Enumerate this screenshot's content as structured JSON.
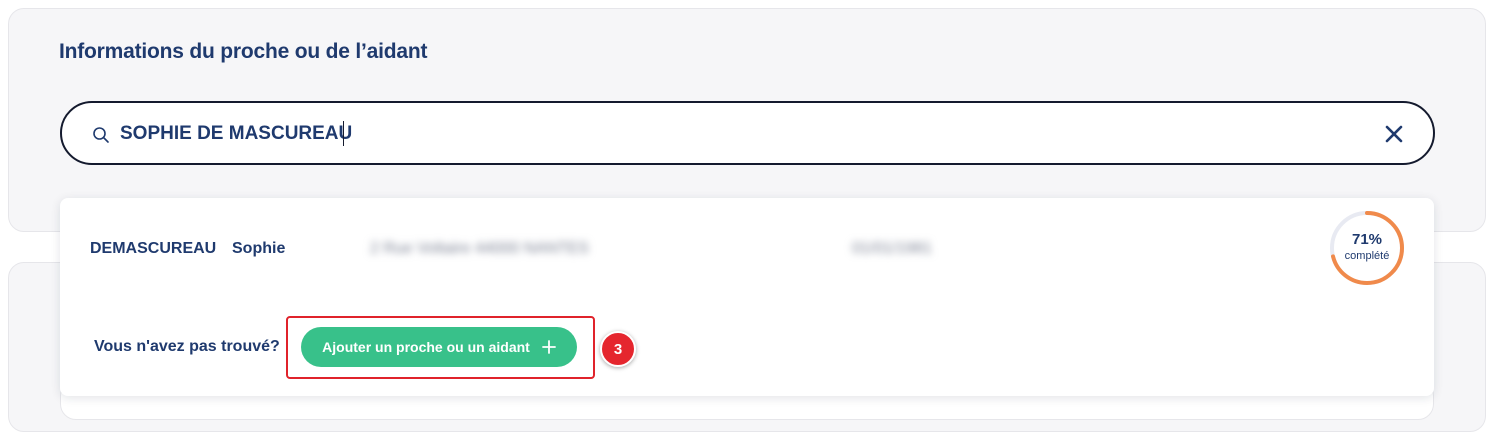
{
  "section": {
    "title": "Informations du proche ou de l’aidant"
  },
  "search": {
    "value": "SOPHIE DE MASCUREAU",
    "icon": "search-icon",
    "clear_icon": "close-icon"
  },
  "results": [
    {
      "last_name": "DEMASCUREAU",
      "first_name": "Sophie",
      "address": "2 Rue Voltaire 44000 NANTES",
      "birth_date": "01/01/1981",
      "completion": {
        "percent": 71,
        "label": "71%",
        "caption": "complété",
        "color": "#f08a4b",
        "track_color": "#e8eaf2"
      }
    }
  ],
  "not_found": {
    "question": "Vous n'avez pas trouvé?",
    "add_button_label": "Ajouter un proche ou un aidant",
    "add_icon": "plus-icon",
    "button_color": "#38c18a"
  },
  "annotation": {
    "step": "3",
    "color": "#e5262e"
  }
}
